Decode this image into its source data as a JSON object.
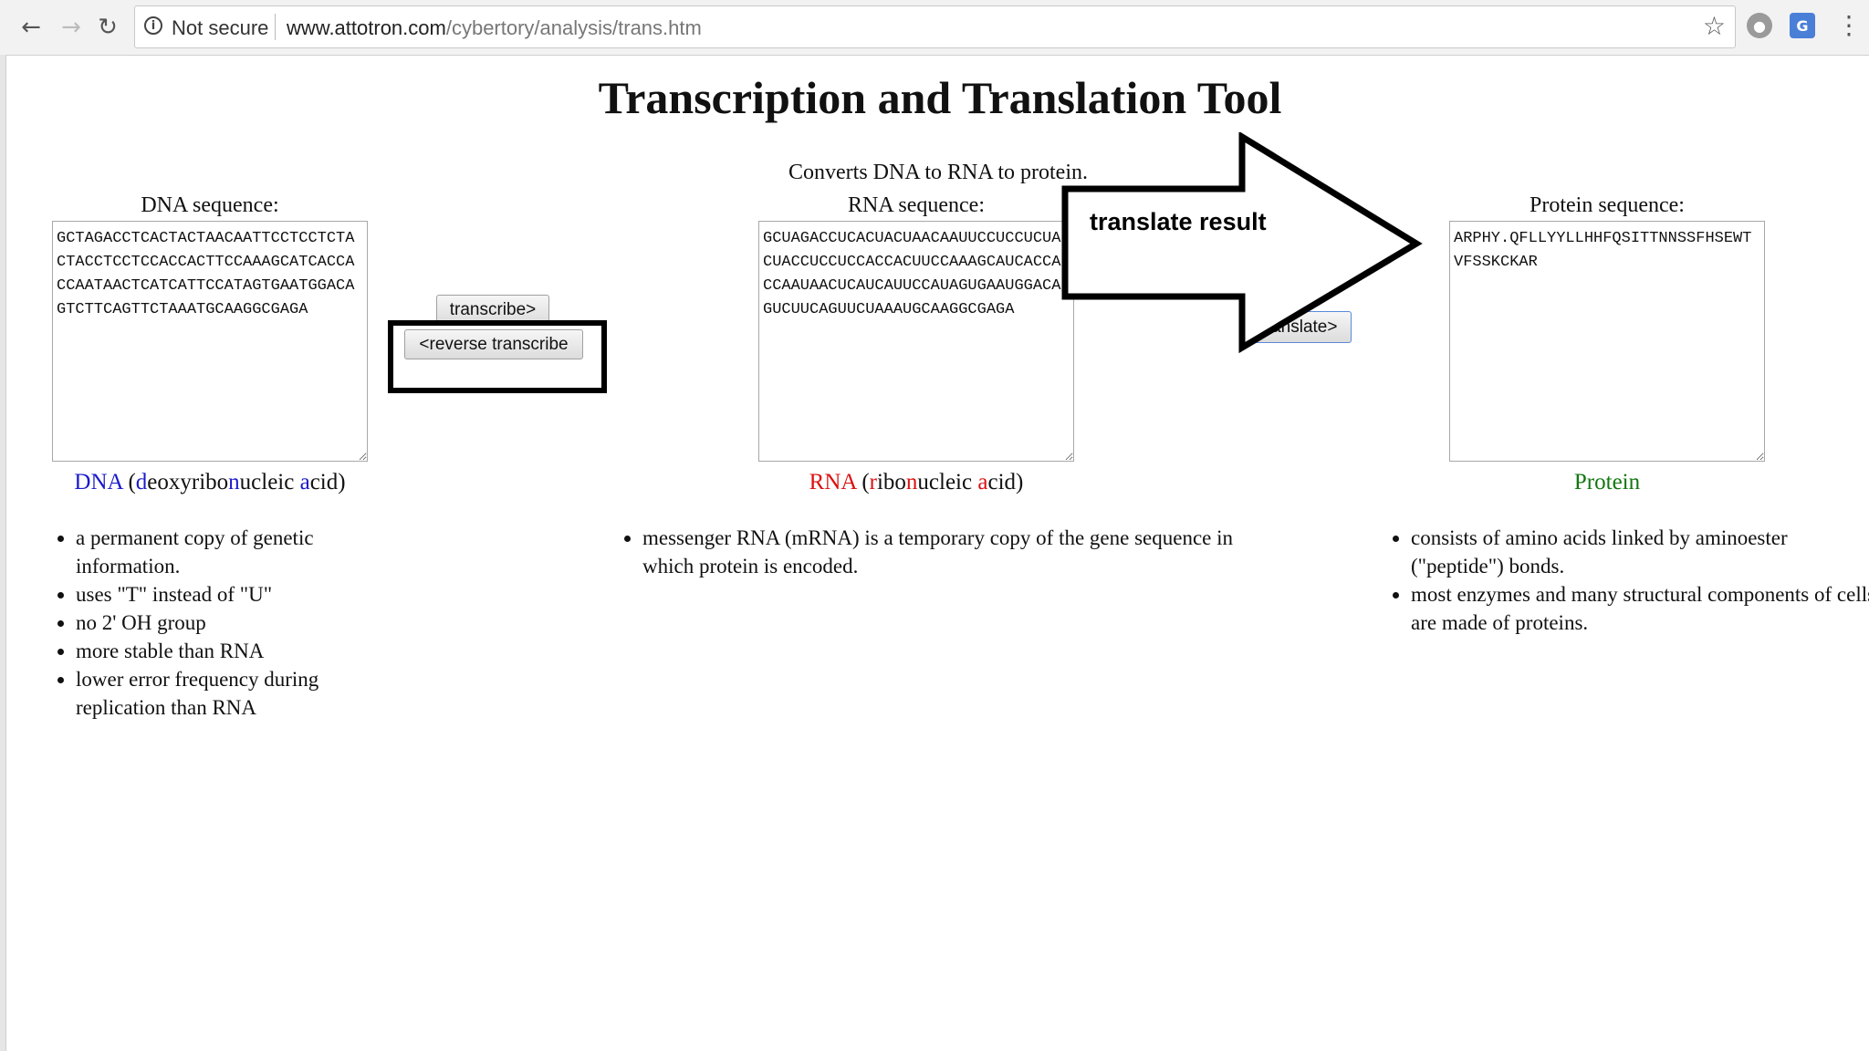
{
  "browser": {
    "security_label": "Not secure",
    "url_host": "www.attotron.com",
    "url_path": "/cybertory/analysis/trans.htm"
  },
  "page": {
    "title": "Transcription and Translation Tool",
    "subtitle": "Converts DNA to RNA to protein."
  },
  "dna": {
    "label": "DNA sequence:",
    "value": "GCTAGACCTCACTACTAACAATTCCTCCTCTACTACCTCCTCCACCACTTCCAAAGCATCACCACCAATAACTCATCATTCCATAGTGAATGGACAGTCTTCAGTTCTAAATGCAAGGCGAGA",
    "caption_term": "DNA",
    "caption_parts": [
      "(",
      "d",
      "eoxyribo",
      "n",
      "ucleic ",
      "a",
      "cid)"
    ],
    "facts": [
      "a permanent copy of genetic information.",
      "uses \"T\" instead of \"U\"",
      "no 2' OH group",
      "more stable than RNA",
      "lower error frequency during replication than RNA"
    ]
  },
  "buttons": {
    "transcribe": "transcribe>",
    "reverse_transcribe": "<reverse transcribe",
    "translate": "translate>"
  },
  "rna": {
    "label": "RNA sequence:",
    "value": "GCUAGACCUCACUACUAACAAUUCCUCCUCUACUACCUCCUCCACCACUUCCAAAGCAUCACCACCAAUAACUCAUCAUUCCAUAGUGAAUGGACAGUCUUCAGUUCUAAAUGCAAGGCGAGA",
    "caption_term": "RNA",
    "caption_parts": [
      "(",
      "r",
      "ibo",
      "n",
      "ucleic ",
      "a",
      "cid)"
    ],
    "facts": [
      "messenger RNA (mRNA) is a temporary copy of the gene sequence in which protein is encoded."
    ]
  },
  "protein": {
    "label": "Protein sequence:",
    "value": "ARPHY.QFLLYYLLHHFQSITTNNSSFHSEWTVFSSKCKAR",
    "caption_term": "Protein",
    "facts": [
      "consists of amino acids linked by aminoester (\"peptide\") bonds.",
      "most enzymes and many structural components of cells are made of proteins."
    ]
  },
  "annotation": {
    "arrow_text": "translate result"
  },
  "colors": {
    "dna_accent": "#1a1acc",
    "rna_accent": "#dd1111",
    "protein_accent": "#117711"
  }
}
